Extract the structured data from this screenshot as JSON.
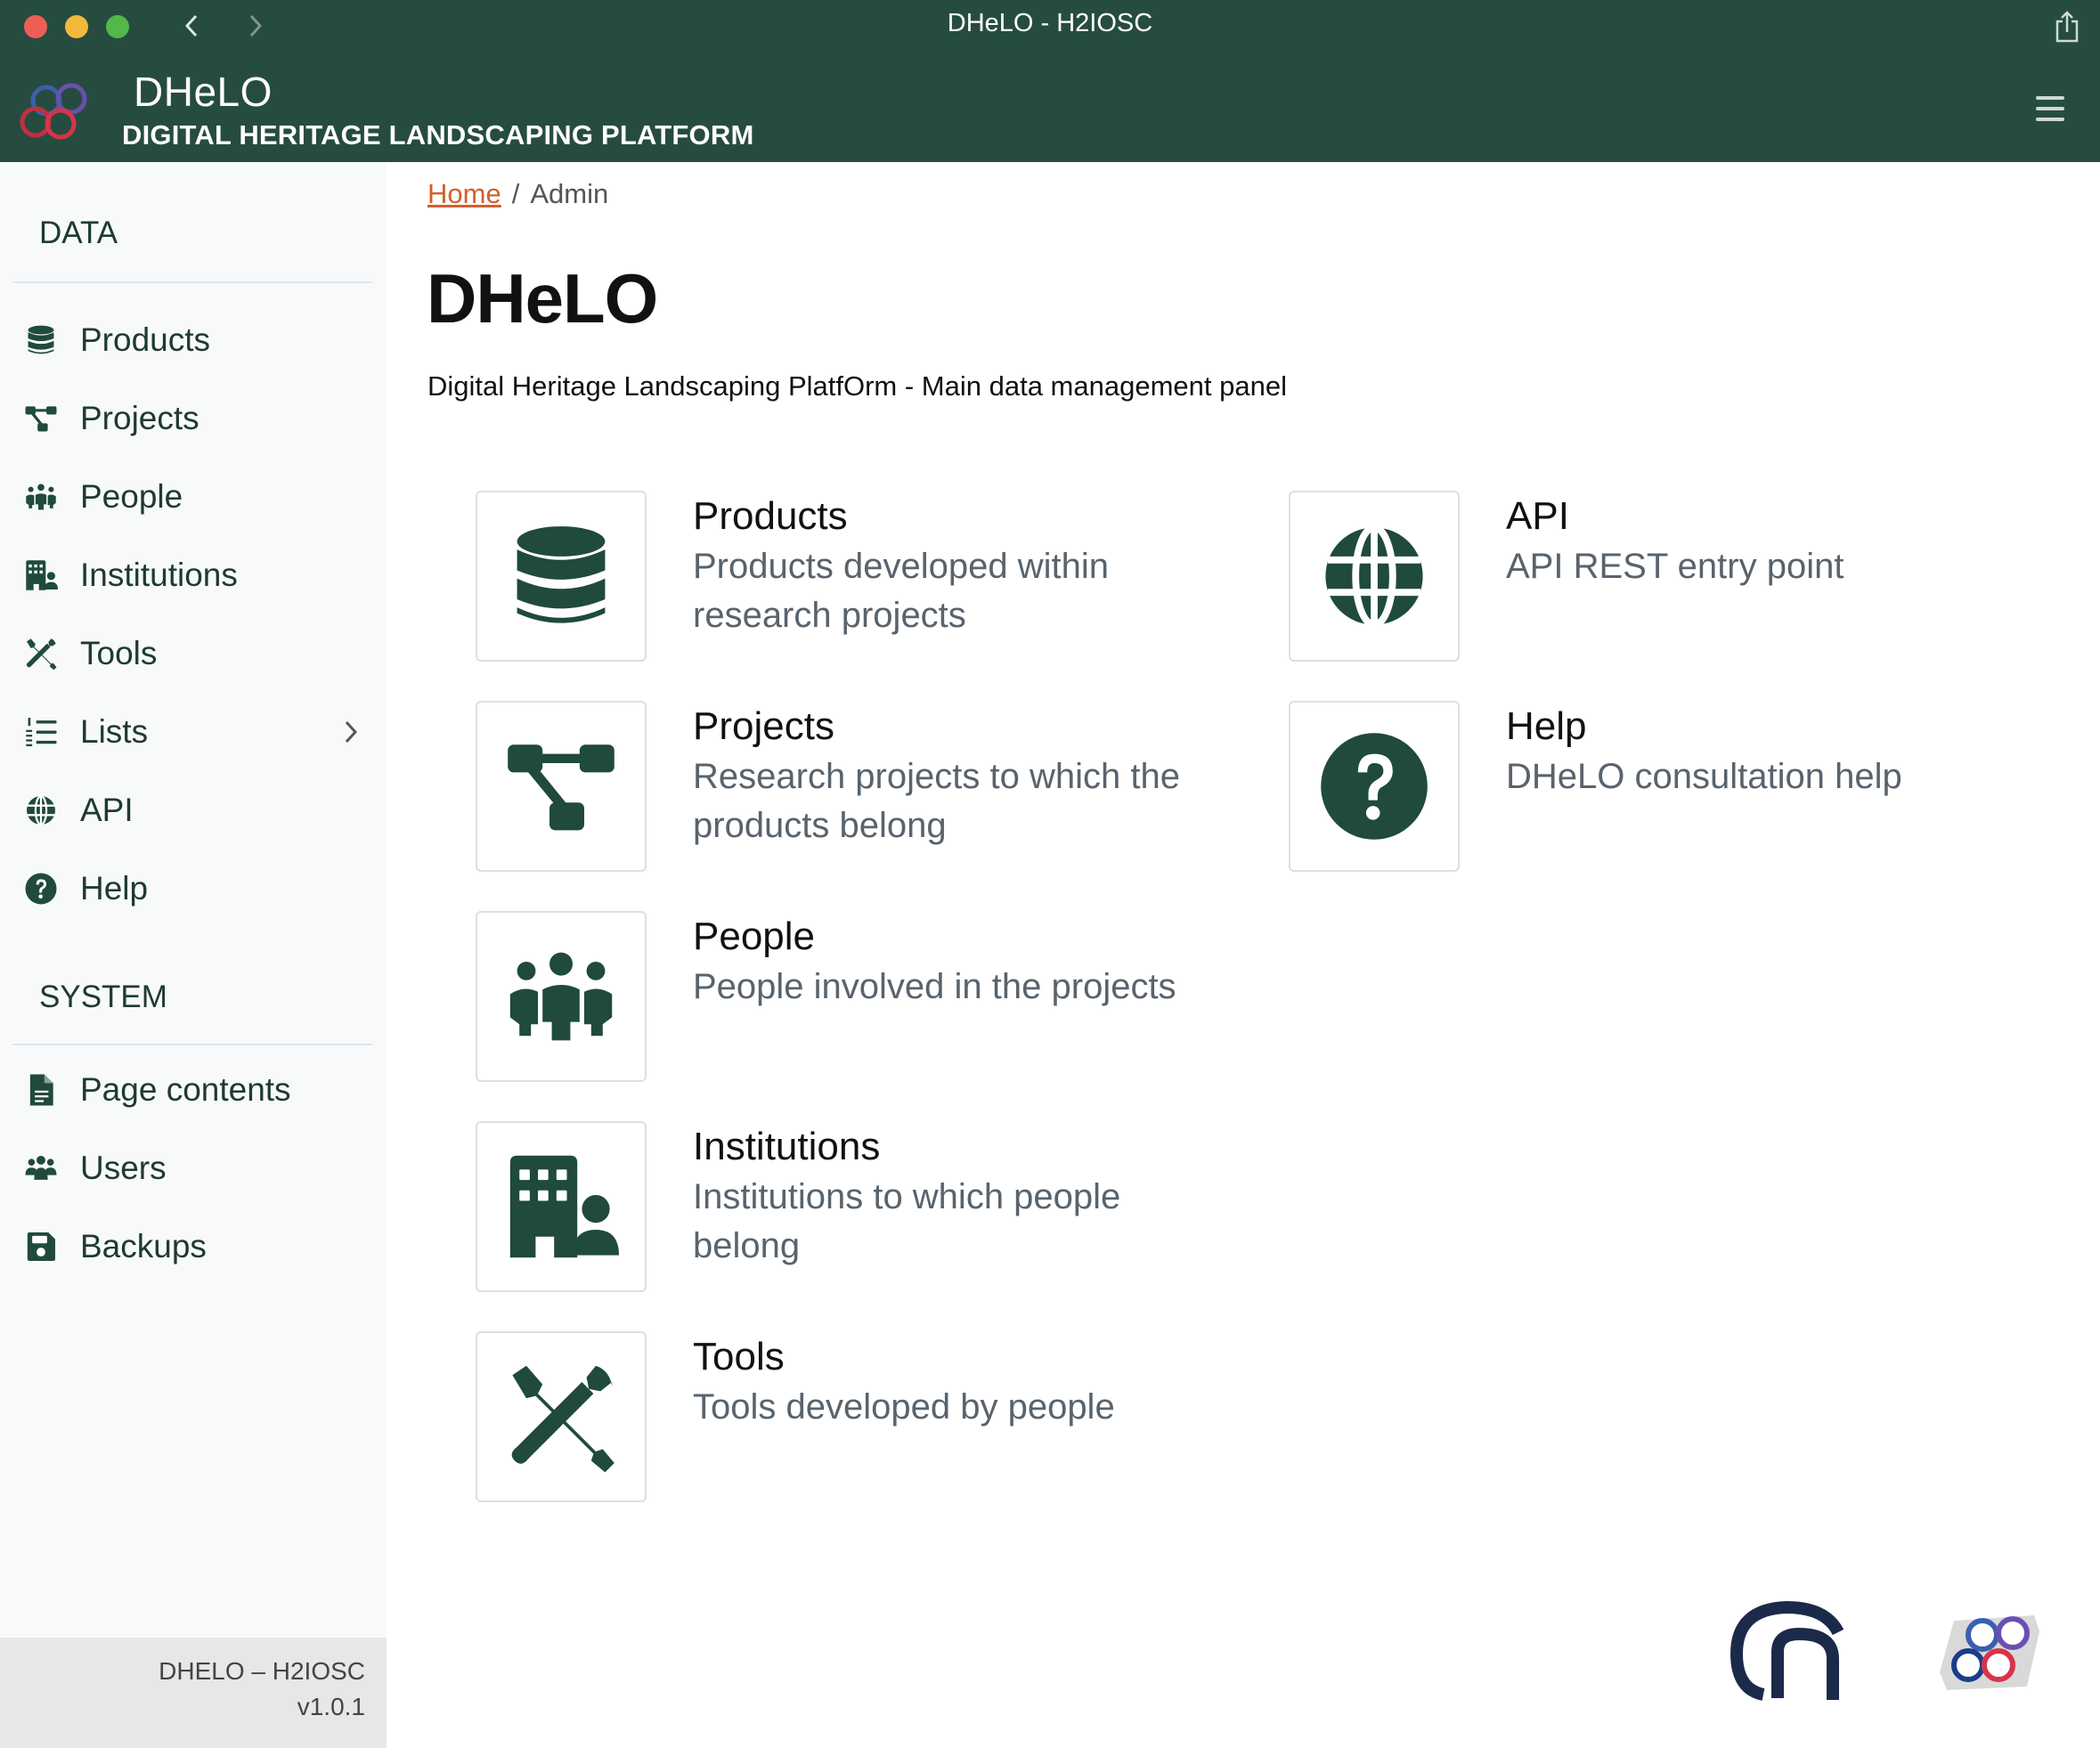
{
  "window": {
    "title": "DHeLO - H2IOSC"
  },
  "header": {
    "brand_name": "DHeLO",
    "brand_tagline": "DIGITAL HERITAGE LANDSCAPING PLATFORM"
  },
  "colors": {
    "header_bg": "#264c40",
    "accent": "#1f4a3c",
    "link": "#d35f2e"
  },
  "sidebar": {
    "data_heading": "DATA",
    "data_items": [
      {
        "label": "Products",
        "icon": "database-icon"
      },
      {
        "label": "Projects",
        "icon": "project-diagram-icon"
      },
      {
        "label": "People",
        "icon": "people-group-icon"
      },
      {
        "label": "Institutions",
        "icon": "building-user-icon"
      },
      {
        "label": "Tools",
        "icon": "tools-icon"
      },
      {
        "label": "Lists",
        "icon": "list-ol-icon"
      },
      {
        "label": "API",
        "icon": "globe-icon"
      },
      {
        "label": "Help",
        "icon": "question-circle-icon"
      }
    ],
    "system_heading": "SYSTEM",
    "system_items": [
      {
        "label": "Page contents",
        "icon": "file-lines-icon"
      },
      {
        "label": "Users",
        "icon": "users-icon"
      },
      {
        "label": "Backups",
        "icon": "floppy-disk-icon"
      }
    ],
    "footer_name": "DHELO – H2IOSC",
    "footer_version": "v1.0.1"
  },
  "breadcrumb": {
    "home": "Home",
    "separator": "/",
    "current": "Admin"
  },
  "main": {
    "title": "DHeLO",
    "subtitle": "Digital Heritage Landscaping PlatfOrm - Main data management panel",
    "cards": [
      {
        "title": "Products",
        "description": "Products developed within research projects",
        "icon": "database-icon"
      },
      {
        "title": "Projects",
        "description": "Research projects to which the products belong",
        "icon": "project-diagram-icon"
      },
      {
        "title": "People",
        "description": "People involved in the projects",
        "icon": "people-group-icon"
      },
      {
        "title": "Institutions",
        "description": "Institutions to which people belong",
        "icon": "building-user-icon"
      },
      {
        "title": "Tools",
        "description": "Tools developed by people",
        "icon": "tools-icon"
      },
      {
        "title": "API",
        "description": "API REST entry point",
        "icon": "globe-icon"
      },
      {
        "title": "Help",
        "description": "DHeLO consultation help",
        "icon": "question-circle-icon"
      }
    ]
  }
}
